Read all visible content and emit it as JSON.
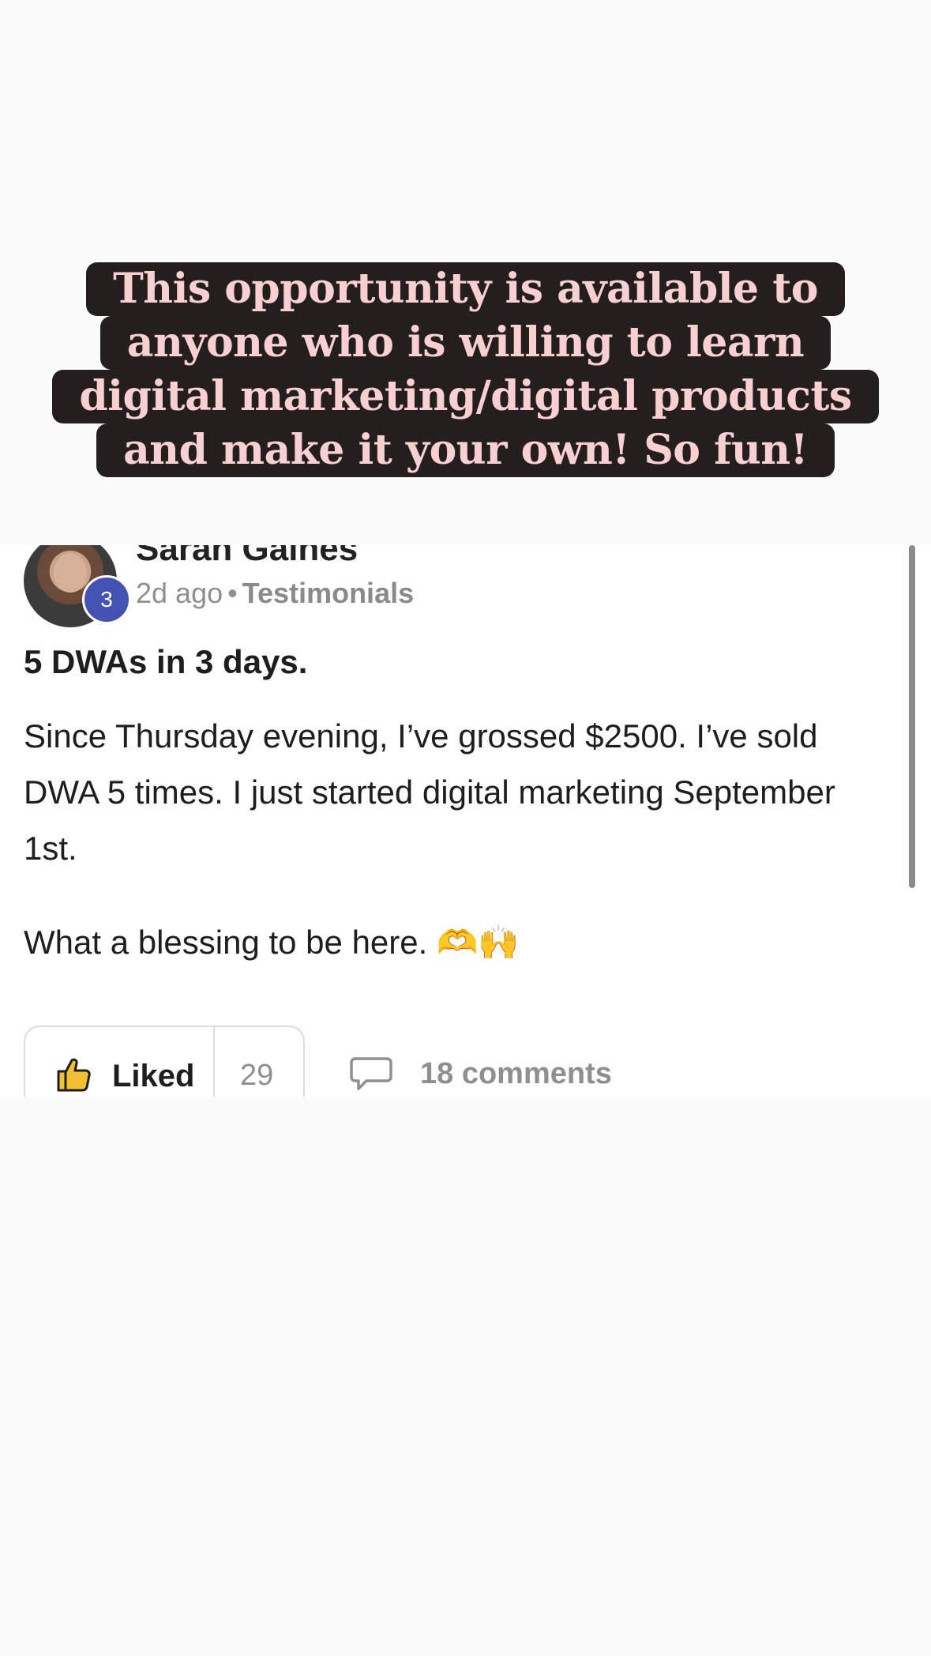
{
  "caption": {
    "lines": [
      "This opportunity is available to",
      "anyone who is willing to learn",
      "digital marketing/digital products",
      "and make it your own! So fun!"
    ]
  },
  "post": {
    "author": "Sarah Gaines",
    "level": "3",
    "time": "2d ago",
    "separator": "•",
    "category": "Testimonials",
    "title": "5 DWAs in 3 days.",
    "body": [
      "Since Thursday evening, I’ve grossed $2500. I’ve sold DWA 5 times. I just started digital marketing September 1st.",
      "What a blessing to be here. 🫶🙌"
    ],
    "like_label": "Liked",
    "like_count": "29",
    "comments_label": "18 comments"
  },
  "colors": {
    "caption_bg": "#251e1f",
    "caption_text": "#f9d0d2",
    "badge": "#4453b3",
    "like_icon": "#f3c034"
  },
  "icons": {
    "like": "thumbs-up-icon",
    "comment": "speech-bubble-icon"
  }
}
